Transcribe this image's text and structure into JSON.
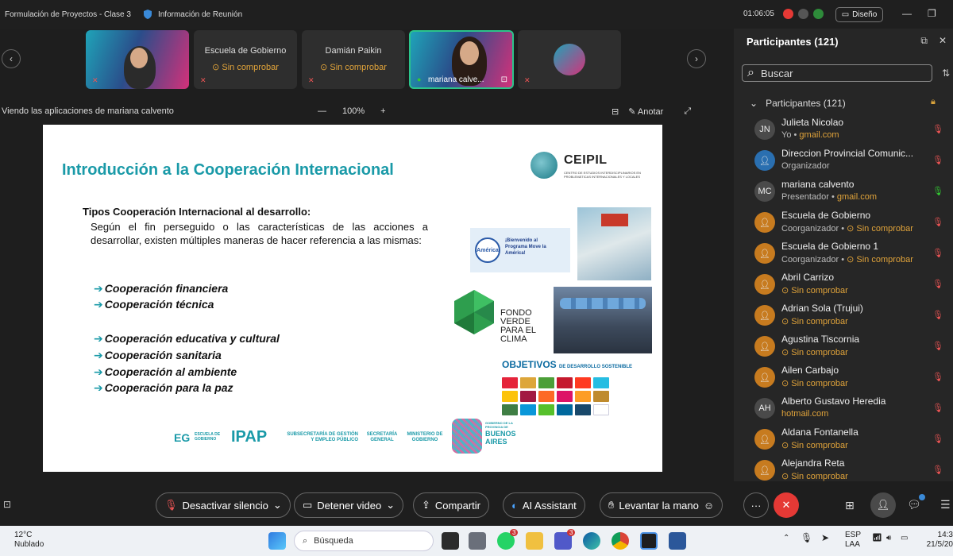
{
  "window": {
    "title": "Formulación de Proyectos - Clase 3",
    "info": "Información de Reunión",
    "time": "01:06:05",
    "layout_label": "Diseño"
  },
  "tiles": [
    {
      "name": "",
      "status": ""
    },
    {
      "name": "Escuela de Gobierno",
      "status": "Sin comprobar"
    },
    {
      "name": "Damián Paikin",
      "status": "Sin comprobar"
    },
    {
      "name": "mariana calve...",
      "status": ""
    },
    {
      "name": "",
      "status": ""
    }
  ],
  "share": {
    "viewing": "Viendo las aplicaciones de mariana calvento",
    "zoom": "100%",
    "minus": "—",
    "plus": "+",
    "annotate": "Anotar"
  },
  "slide": {
    "title": "Introducción a la Cooperación Internacional",
    "subhead": "Tipos Cooperación Internacional al desarrollo:",
    "paragraph": "Según el fin perseguido o las características de las acciones a desarrollar, existen múltiples maneras de hacer referencia a las mismas:",
    "types": [
      "Cooperación financiera",
      "Cooperación técnica",
      "Cooperación educativa  y cultural",
      "Cooperación sanitaria",
      "Cooperación al ambiente",
      "Cooperación para la paz"
    ],
    "ceipil": "CEIPIL",
    "ceipil_sub": "CENTRO DE ESTUDIOS INTERDISCIPLINARIOS EN PROBLEMÁTICAS INTERNACIONALES Y LOCALES",
    "america_text": "¡Bienvenido al Programa Move la América!",
    "america_label": "América",
    "fondo": "FONDO VERDE PARA EL CLIMA",
    "ods": "OBJETIVOS",
    "ods_sub": "DE DESARROLLO SOSTENIBLE",
    "footer_eg": "EG",
    "footer_eg_sub": "ESCUELA DE GOBIERNO",
    "footer_ipap": "IPAP",
    "footer_sub1": "SUBSECRETARÍA DE GESTIÓN Y EMPLEO PÚBLICO",
    "footer_sub2": "SECRETARÍA GENERAL",
    "footer_sub3": "MINISTERIO DE GOBIERNO",
    "ba_small": "GOBIERNO DE LA PROVINCIA DE",
    "ba": "BUENOS AIRES"
  },
  "panel": {
    "title": "Participantes (121)",
    "search_placeholder": "Buscar",
    "section": "Participantes (121)",
    "participants": [
      {
        "initials": "JN",
        "name": "Julieta Nicolao",
        "sub_a": "Yo • ",
        "sub_b": "gmail.com",
        "orange": true,
        "avatar_color": "#4a4a4a",
        "mic_color": "#e55"
      },
      {
        "initials": "",
        "name": "Direccion Provincial Comunic...",
        "sub_a": "Organizador",
        "sub_b": "",
        "orange": false,
        "avatar_color": "#2a6fb0",
        "mic_color": "#e55"
      },
      {
        "initials": "MC",
        "name": "mariana calvento",
        "sub_a": "Presentador • ",
        "sub_b": "gmail.com",
        "orange": true,
        "avatar_color": "#4a4a4a",
        "mic_color": "#3c3"
      },
      {
        "initials": "",
        "name": "Escuela de Gobierno",
        "sub_a": "Coorganizador • ",
        "sub_b": "Sin comprobar",
        "orange": true,
        "avatar_color": "#c77b1f",
        "mic_color": "#e55"
      },
      {
        "initials": "",
        "name": "Escuela de Gobierno 1",
        "sub_a": "Coorganizador • ",
        "sub_b": "Sin comprobar",
        "orange": true,
        "avatar_color": "#c77b1f",
        "mic_color": "#e55"
      },
      {
        "initials": "",
        "name": "Abril Carrizo",
        "sub_a": "",
        "sub_b": "Sin comprobar",
        "orange": true,
        "avatar_color": "#c77b1f",
        "mic_color": "#e55"
      },
      {
        "initials": "",
        "name": "Adrian Sola (Trujui)",
        "sub_a": "",
        "sub_b": "Sin comprobar",
        "orange": true,
        "avatar_color": "#c77b1f",
        "mic_color": "#e55"
      },
      {
        "initials": "",
        "name": "Agustina Tiscornia",
        "sub_a": "",
        "sub_b": "Sin comprobar",
        "orange": true,
        "avatar_color": "#c77b1f",
        "mic_color": "#e55"
      },
      {
        "initials": "",
        "name": "Ailen Carbajo",
        "sub_a": "",
        "sub_b": "Sin comprobar",
        "orange": true,
        "avatar_color": "#c77b1f",
        "mic_color": "#e55"
      },
      {
        "initials": "AH",
        "name": "Alberto Gustavo Heredia",
        "sub_a": "",
        "sub_b": "hotmail.com",
        "orange": true,
        "avatar_color": "#4a4a4a",
        "mic_color": "#e55"
      },
      {
        "initials": "",
        "name": "Aldana Fontanella",
        "sub_a": "",
        "sub_b": "Sin comprobar",
        "orange": true,
        "avatar_color": "#c77b1f",
        "mic_color": "#e55"
      },
      {
        "initials": "",
        "name": "Alejandra Reta",
        "sub_a": "",
        "sub_b": "Sin comprobar",
        "orange": true,
        "avatar_color": "#c77b1f",
        "mic_color": "#e55"
      }
    ]
  },
  "controls": {
    "mute": "Desactivar silencio",
    "video": "Detener video",
    "share": "Compartir",
    "ai": "AI Assistant",
    "hand": "Levantar la mano",
    "more": "···",
    "chat_badge": ""
  },
  "taskbar": {
    "temp": "12°C",
    "weather": "Nublado",
    "search": "Búsqueda",
    "badge1": "3",
    "badge2": "3",
    "lang1": "ESP",
    "lang2": "LAA",
    "clock": "14:3",
    "date": "21/5/20"
  }
}
